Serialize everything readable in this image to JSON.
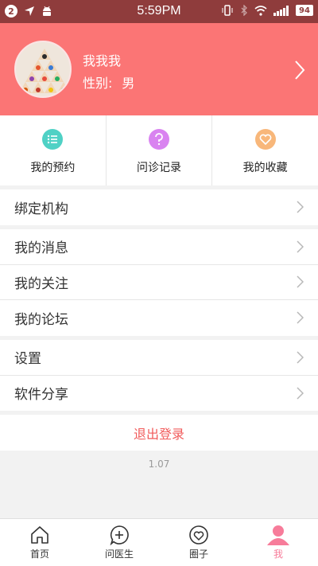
{
  "status_bar": {
    "notification_count": "2",
    "time": "5:59PM",
    "battery": "94"
  },
  "profile": {
    "name": "我我我",
    "gender_label": "性别:",
    "gender_value": "男"
  },
  "quick_actions": [
    {
      "label": "我的预约",
      "icon": "list-icon",
      "color": "#4fd1c5"
    },
    {
      "label": "问诊记录",
      "icon": "question-icon",
      "color": "#d983f0"
    },
    {
      "label": "我的收藏",
      "icon": "heart-icon",
      "color": "#f8b77a"
    }
  ],
  "menu": {
    "group1": [
      "绑定机构"
    ],
    "group2": [
      "我的消息",
      "我的关注",
      "我的论坛"
    ],
    "group3": [
      "设置",
      "软件分享"
    ]
  },
  "logout_label": "退出登录",
  "version": "1.07",
  "tabs": [
    {
      "label": "首页",
      "icon": "home-icon"
    },
    {
      "label": "问医生",
      "icon": "ask-doctor-icon"
    },
    {
      "label": "圈子",
      "icon": "circle-heart-icon"
    },
    {
      "label": "我",
      "icon": "user-icon",
      "active": true
    }
  ],
  "colors": {
    "header": "#fb7575",
    "status_bar": "#8f3c3c",
    "accent": "#f77c9a",
    "logout": "#f15b5b"
  }
}
